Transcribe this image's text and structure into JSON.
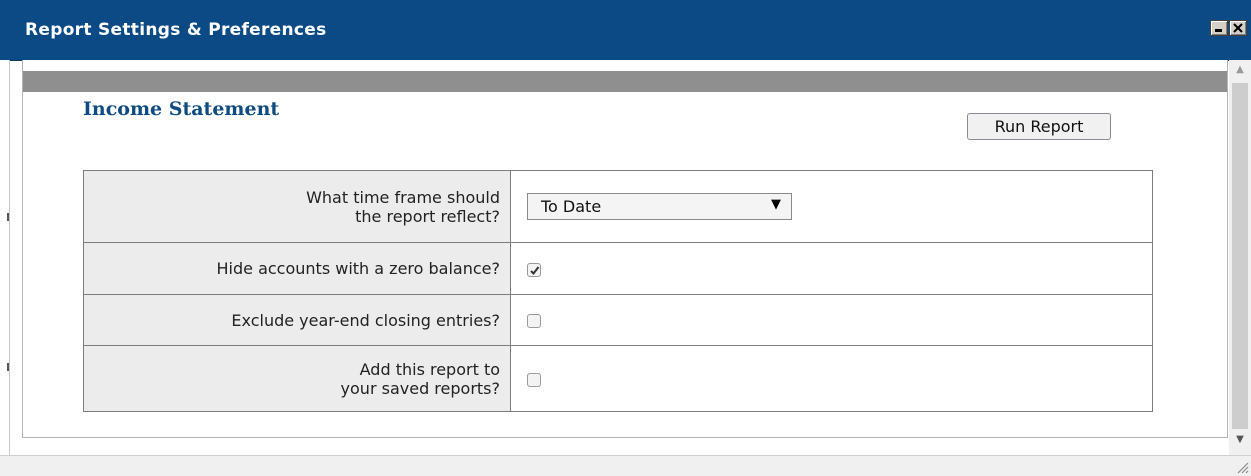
{
  "window": {
    "title": "Report Settings & Preferences",
    "minimize_icon": "minimize-icon",
    "close_icon": "close-icon"
  },
  "report": {
    "heading": "Income Statement",
    "run_button": "Run Report"
  },
  "settings": {
    "time_frame": {
      "label_line1": "What time frame should",
      "label_line2": "the report reflect?",
      "selected": "To Date"
    },
    "hide_zero": {
      "label": "Hide accounts with a zero balance?",
      "checked": true
    },
    "exclude_closing": {
      "label": "Exclude year-end closing entries?",
      "checked": false
    },
    "add_saved": {
      "label_line1": "Add this report to",
      "label_line2": "your saved reports?",
      "checked": false
    }
  },
  "colors": {
    "titlebar": "#0b4a84",
    "heading": "#0e4b80",
    "band": "#8f8f8f",
    "label_bg": "#ececec"
  }
}
